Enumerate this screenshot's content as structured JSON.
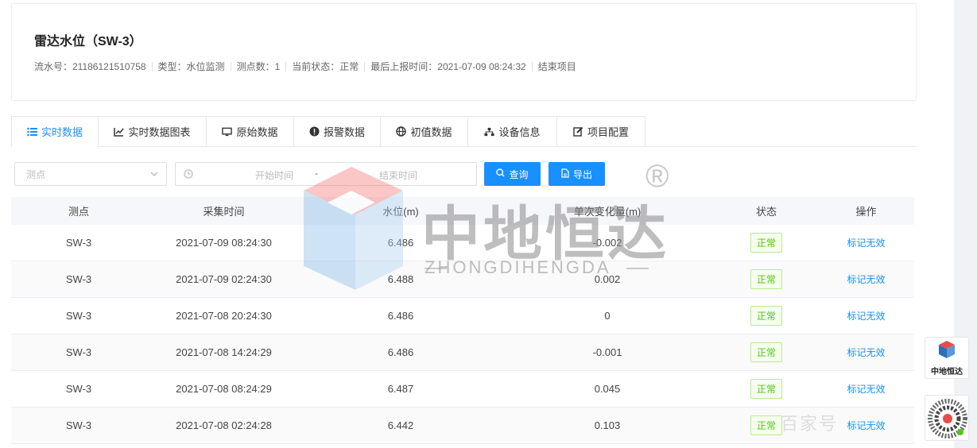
{
  "header": {
    "title": "雷达水位（SW-3）",
    "meta": [
      "流水号：21186121510758",
      "类型：水位监测",
      "测点数：1",
      "当前状态：正常",
      "最后上报时间：2021-07-09 08:24:32",
      "结束项目"
    ]
  },
  "tabs": [
    {
      "label": "实时数据",
      "icon": "list-icon",
      "active": true
    },
    {
      "label": "实时数据图表",
      "icon": "line-chart-icon",
      "active": false
    },
    {
      "label": "原始数据",
      "icon": "monitor-icon",
      "active": false
    },
    {
      "label": "报警数据",
      "icon": "alert-icon",
      "active": false
    },
    {
      "label": "初值数据",
      "icon": "globe-icon",
      "active": false
    },
    {
      "label": "设备信息",
      "icon": "sitemap-icon",
      "active": false
    },
    {
      "label": "项目配置",
      "icon": "edit-icon",
      "active": false
    }
  ],
  "filters": {
    "point_placeholder": "测点",
    "start_placeholder": "开始时间",
    "range_separator": "-",
    "end_placeholder": "结束时间",
    "query_label": "查询",
    "export_label": "导出"
  },
  "table": {
    "columns": [
      "测点",
      "采集时间",
      "水位(m)",
      "单次变化量(m)",
      "状态",
      "操作"
    ],
    "rows": [
      {
        "point": "SW-3",
        "time": "2021-07-09 08:24:30",
        "level": "6.486",
        "change": "-0.002",
        "status": "正常",
        "action": "标记无效"
      },
      {
        "point": "SW-3",
        "time": "2021-07-09 02:24:30",
        "level": "6.488",
        "change": "0.002",
        "status": "正常",
        "action": "标记无效"
      },
      {
        "point": "SW-3",
        "time": "2021-07-08 20:24:30",
        "level": "6.486",
        "change": "0",
        "status": "正常",
        "action": "标记无效"
      },
      {
        "point": "SW-3",
        "time": "2021-07-08 14:24:29",
        "level": "6.486",
        "change": "-0.001",
        "status": "正常",
        "action": "标记无效"
      },
      {
        "point": "SW-3",
        "time": "2021-07-08 08:24:29",
        "level": "6.487",
        "change": "0.045",
        "status": "正常",
        "action": "标记无效"
      },
      {
        "point": "SW-3",
        "time": "2021-07-08 02:24:28",
        "level": "6.442",
        "change": "0.103",
        "status": "正常",
        "action": "标记无效"
      }
    ]
  },
  "watermark": {
    "cn": "中地恒达",
    "en": "ZHONGDIHENGDA",
    "reg": "®",
    "corner": "百家号"
  },
  "float_logo_text": "中地恒达",
  "colors": {
    "primary": "#1890ff",
    "success": "#52c41a",
    "border": "#ebeef5"
  }
}
